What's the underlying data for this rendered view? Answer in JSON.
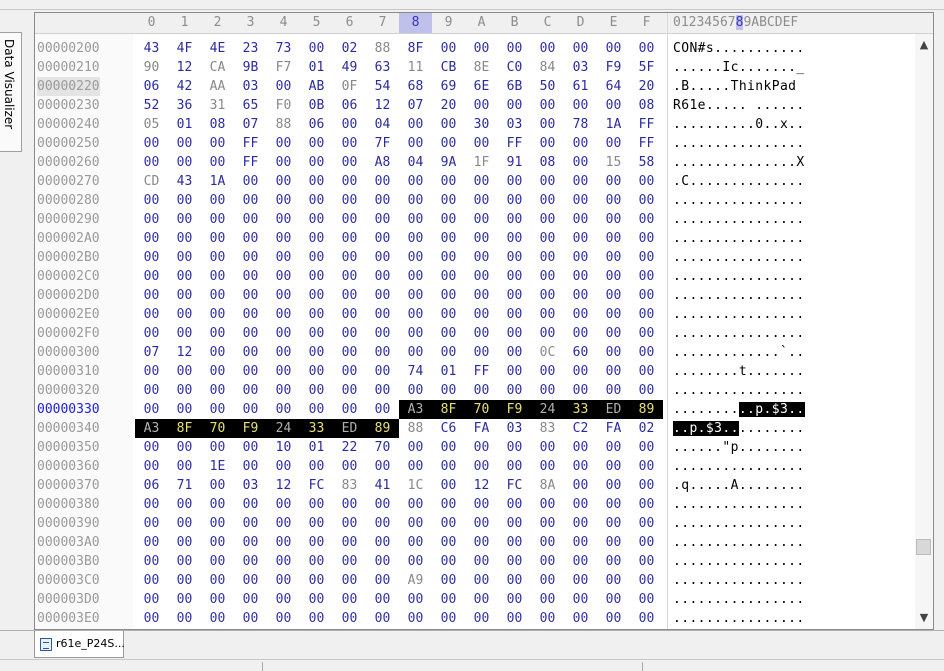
{
  "side_panel": {
    "tab_label": "Data Visualizer"
  },
  "editor": {
    "header_columns": [
      "0",
      "1",
      "2",
      "3",
      "4",
      "5",
      "6",
      "7",
      "8",
      "9",
      "A",
      "B",
      "C",
      "D",
      "E",
      "F"
    ],
    "selected_column": "8",
    "ascii_header_before": "01234567",
    "ascii_header_selected": "8",
    "ascii_header_after": "9ABCDEF",
    "current_address": "00000330",
    "highlighted_row_address": "00000220",
    "rows": [
      {
        "addr": "00000200",
        "bytes": [
          "43",
          "4F",
          "4E",
          "23",
          "73",
          "00",
          "02",
          "88",
          "8F",
          "00",
          "00",
          "00",
          "00",
          "00",
          "00",
          "00"
        ],
        "ascii": "CON#s..........."
      },
      {
        "addr": "00000210",
        "bytes": [
          "90",
          "12",
          "CA",
          "9B",
          "F7",
          "01",
          "49",
          "63",
          "11",
          "CB",
          "8E",
          "C0",
          "84",
          "03",
          "F9",
          "5F"
        ],
        "ascii": "......Ic......._"
      },
      {
        "addr": "00000220",
        "bytes": [
          "06",
          "42",
          "AA",
          "03",
          "00",
          "AB",
          "0F",
          "54",
          "68",
          "69",
          "6E",
          "6B",
          "50",
          "61",
          "64",
          "20"
        ],
        "ascii": ".B.....ThinkPad "
      },
      {
        "addr": "00000230",
        "bytes": [
          "52",
          "36",
          "31",
          "65",
          "F0",
          "0B",
          "06",
          "12",
          "07",
          "20",
          "00",
          "00",
          "00",
          "00",
          "00",
          "08"
        ],
        "ascii": "R61e..... ......"
      },
      {
        "addr": "00000240",
        "bytes": [
          "05",
          "01",
          "08",
          "07",
          "88",
          "06",
          "00",
          "04",
          "00",
          "00",
          "30",
          "03",
          "00",
          "78",
          "1A",
          "FF"
        ],
        "ascii": "..........0..x.."
      },
      {
        "addr": "00000250",
        "bytes": [
          "00",
          "00",
          "00",
          "FF",
          "00",
          "00",
          "00",
          "7F",
          "00",
          "00",
          "00",
          "FF",
          "00",
          "00",
          "00",
          "FF"
        ],
        "ascii": "................"
      },
      {
        "addr": "00000260",
        "bytes": [
          "00",
          "00",
          "00",
          "FF",
          "00",
          "00",
          "00",
          "A8",
          "04",
          "9A",
          "1F",
          "91",
          "08",
          "00",
          "15",
          "58"
        ],
        "ascii": "...............X"
      },
      {
        "addr": "00000270",
        "bytes": [
          "CD",
          "43",
          "1A",
          "00",
          "00",
          "00",
          "00",
          "00",
          "00",
          "00",
          "00",
          "00",
          "00",
          "00",
          "00",
          "00"
        ],
        "ascii": ".C.............."
      },
      {
        "addr": "00000280",
        "bytes": [
          "00",
          "00",
          "00",
          "00",
          "00",
          "00",
          "00",
          "00",
          "00",
          "00",
          "00",
          "00",
          "00",
          "00",
          "00",
          "00"
        ],
        "ascii": "................"
      },
      {
        "addr": "00000290",
        "bytes": [
          "00",
          "00",
          "00",
          "00",
          "00",
          "00",
          "00",
          "00",
          "00",
          "00",
          "00",
          "00",
          "00",
          "00",
          "00",
          "00"
        ],
        "ascii": "................"
      },
      {
        "addr": "000002A0",
        "bytes": [
          "00",
          "00",
          "00",
          "00",
          "00",
          "00",
          "00",
          "00",
          "00",
          "00",
          "00",
          "00",
          "00",
          "00",
          "00",
          "00"
        ],
        "ascii": "................"
      },
      {
        "addr": "000002B0",
        "bytes": [
          "00",
          "00",
          "00",
          "00",
          "00",
          "00",
          "00",
          "00",
          "00",
          "00",
          "00",
          "00",
          "00",
          "00",
          "00",
          "00"
        ],
        "ascii": "................"
      },
      {
        "addr": "000002C0",
        "bytes": [
          "00",
          "00",
          "00",
          "00",
          "00",
          "00",
          "00",
          "00",
          "00",
          "00",
          "00",
          "00",
          "00",
          "00",
          "00",
          "00"
        ],
        "ascii": "................"
      },
      {
        "addr": "000002D0",
        "bytes": [
          "00",
          "00",
          "00",
          "00",
          "00",
          "00",
          "00",
          "00",
          "00",
          "00",
          "00",
          "00",
          "00",
          "00",
          "00",
          "00"
        ],
        "ascii": "................"
      },
      {
        "addr": "000002E0",
        "bytes": [
          "00",
          "00",
          "00",
          "00",
          "00",
          "00",
          "00",
          "00",
          "00",
          "00",
          "00",
          "00",
          "00",
          "00",
          "00",
          "00"
        ],
        "ascii": "................"
      },
      {
        "addr": "000002F0",
        "bytes": [
          "00",
          "00",
          "00",
          "00",
          "00",
          "00",
          "00",
          "00",
          "00",
          "00",
          "00",
          "00",
          "00",
          "00",
          "00",
          "00"
        ],
        "ascii": "................"
      },
      {
        "addr": "00000300",
        "bytes": [
          "07",
          "12",
          "00",
          "00",
          "00",
          "00",
          "00",
          "00",
          "00",
          "00",
          "00",
          "00",
          "0C",
          "60",
          "00",
          "00"
        ],
        "ascii": ".............`.."
      },
      {
        "addr": "00000310",
        "bytes": [
          "00",
          "00",
          "00",
          "00",
          "00",
          "00",
          "00",
          "00",
          "74",
          "01",
          "FF",
          "00",
          "00",
          "00",
          "00",
          "00"
        ],
        "ascii": "........t......."
      },
      {
        "addr": "00000320",
        "bytes": [
          "00",
          "00",
          "00",
          "00",
          "00",
          "00",
          "00",
          "00",
          "00",
          "00",
          "00",
          "00",
          "00",
          "00",
          "00",
          "00"
        ],
        "ascii": "................"
      },
      {
        "addr": "00000330",
        "bytes": [
          "00",
          "00",
          "00",
          "00",
          "00",
          "00",
          "00",
          "00",
          "A3",
          "8F",
          "70",
          "F9",
          "24",
          "33",
          "ED",
          "89"
        ],
        "ascii": "..........p.$3.."
      },
      {
        "addr": "00000340",
        "bytes": [
          "A3",
          "8F",
          "70",
          "F9",
          "24",
          "33",
          "ED",
          "89",
          "88",
          "C6",
          "FA",
          "03",
          "83",
          "C2",
          "FA",
          "02"
        ],
        "ascii": "..p.$3.........."
      },
      {
        "addr": "00000350",
        "bytes": [
          "00",
          "00",
          "00",
          "00",
          "10",
          "01",
          "22",
          "70",
          "00",
          "00",
          "00",
          "00",
          "00",
          "00",
          "00",
          "00"
        ],
        "ascii": "......\"p........"
      },
      {
        "addr": "00000360",
        "bytes": [
          "00",
          "00",
          "1E",
          "00",
          "00",
          "00",
          "00",
          "00",
          "00",
          "00",
          "00",
          "00",
          "00",
          "00",
          "00",
          "00"
        ],
        "ascii": "................"
      },
      {
        "addr": "00000370",
        "bytes": [
          "06",
          "71",
          "00",
          "03",
          "12",
          "FC",
          "83",
          "41",
          "1C",
          "00",
          "12",
          "FC",
          "8A",
          "00",
          "00",
          "00"
        ],
        "ascii": ".q.....A........"
      },
      {
        "addr": "00000380",
        "bytes": [
          "00",
          "00",
          "00",
          "00",
          "00",
          "00",
          "00",
          "00",
          "00",
          "00",
          "00",
          "00",
          "00",
          "00",
          "00",
          "00"
        ],
        "ascii": "................"
      },
      {
        "addr": "00000390",
        "bytes": [
          "00",
          "00",
          "00",
          "00",
          "00",
          "00",
          "00",
          "00",
          "00",
          "00",
          "00",
          "00",
          "00",
          "00",
          "00",
          "00"
        ],
        "ascii": "................"
      },
      {
        "addr": "000003A0",
        "bytes": [
          "00",
          "00",
          "00",
          "00",
          "00",
          "00",
          "00",
          "00",
          "00",
          "00",
          "00",
          "00",
          "00",
          "00",
          "00",
          "00"
        ],
        "ascii": "................"
      },
      {
        "addr": "000003B0",
        "bytes": [
          "00",
          "00",
          "00",
          "00",
          "00",
          "00",
          "00",
          "00",
          "00",
          "00",
          "00",
          "00",
          "00",
          "00",
          "00",
          "00"
        ],
        "ascii": "................"
      },
      {
        "addr": "000003C0",
        "bytes": [
          "00",
          "00",
          "00",
          "00",
          "00",
          "00",
          "00",
          "00",
          "A9",
          "00",
          "00",
          "00",
          "00",
          "00",
          "00",
          "00"
        ],
        "ascii": "................"
      },
      {
        "addr": "000003D0",
        "bytes": [
          "00",
          "00",
          "00",
          "00",
          "00",
          "00",
          "00",
          "00",
          "00",
          "00",
          "00",
          "00",
          "00",
          "00",
          "00",
          "00"
        ],
        "ascii": "................"
      },
      {
        "addr": "000003E0",
        "bytes": [
          "00",
          "00",
          "00",
          "00",
          "00",
          "00",
          "00",
          "00",
          "00",
          "00",
          "00",
          "00",
          "00",
          "00",
          "00",
          "00"
        ],
        "ascii": "................"
      }
    ],
    "selection": {
      "start": "00000338",
      "length": 16
    }
  },
  "scrollbar": {
    "up_icon": "▲",
    "down_icon": "▼",
    "position": 0.9
  },
  "document_tab": {
    "label": "r61e_P24S..."
  },
  "colors": {
    "zero_byte": "#3030a8",
    "nonzero_byte": "#888888",
    "selection_bg": "#000000",
    "selection_fg": "#e8e070",
    "address": "#9a9a9a",
    "current_address": "#2020d8",
    "column_selected": "#c0c0ec"
  }
}
